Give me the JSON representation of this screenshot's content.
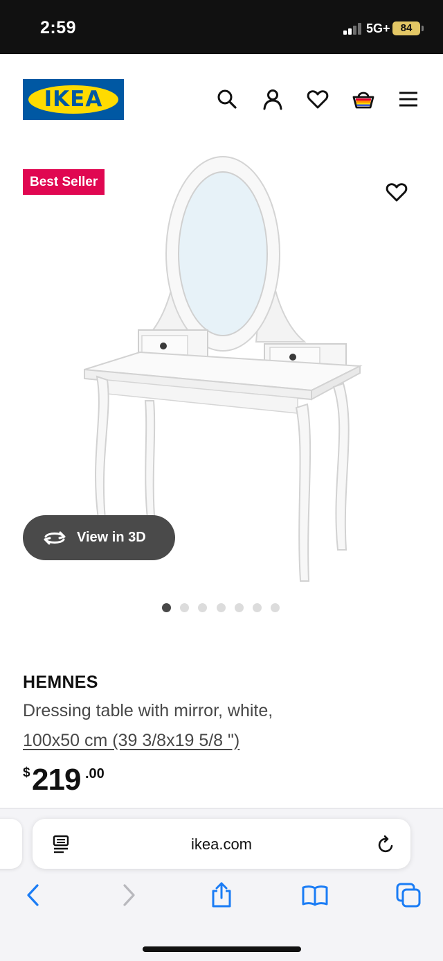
{
  "status_bar": {
    "time": "2:59",
    "network": "5G+",
    "battery": "84",
    "battery_icon": "battery-charging-icon"
  },
  "header": {
    "logo_text": "IKEA",
    "logo_colors": {
      "blue": "#0058a3",
      "yellow": "#ffdb00"
    },
    "icons": [
      "search-icon",
      "account-icon",
      "favourites-icon",
      "shopping-bag-icon",
      "menu-icon"
    ]
  },
  "gallery": {
    "badge": "Best Seller",
    "badge_color": "#e00751",
    "favourite_icon": "heart-icon",
    "view_3d_label": "View in 3D",
    "dots_total": 7,
    "dots_active": 1
  },
  "product": {
    "name": "HEMNES",
    "description": "Dressing table with mirror, white,",
    "size": "100x50 cm (39 3/8x19 5/8 \")",
    "price": {
      "currency": "$",
      "integer": "219",
      "decimal": ".00"
    }
  },
  "browser": {
    "url": "ikea.com",
    "accent": "#1a7cf5",
    "icons": [
      "reader-icon",
      "reload-icon",
      "back-icon",
      "forward-icon",
      "share-icon",
      "bookmarks-icon",
      "tabs-icon"
    ]
  }
}
